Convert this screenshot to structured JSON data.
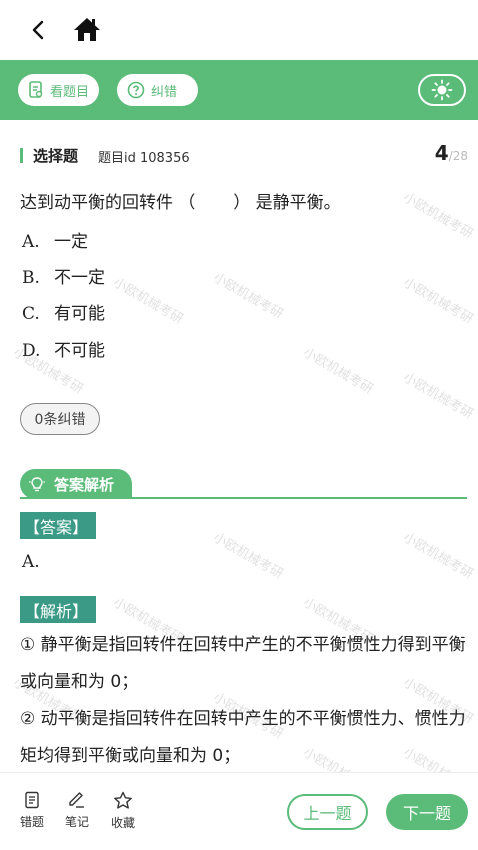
{
  "nav": {
    "back_icon": "chevron-left-icon",
    "home_icon": "home-icon"
  },
  "toolbar": {
    "view_question_label": "看题目",
    "correction_label": "纠错",
    "theme_icon": "sun-icon",
    "accent_color": "#5bbb78"
  },
  "question": {
    "type": "选择题",
    "id_label": "题目id 108356",
    "current": "4",
    "total": "/28",
    "stem": "达到动平衡的回转件 （       ） 是静平衡。",
    "options": [
      {
        "letter": "A.",
        "text": "一定"
      },
      {
        "letter": "B.",
        "text": "不一定"
      },
      {
        "letter": "C.",
        "text": "有可能"
      },
      {
        "letter": "D.",
        "text": "不可能"
      }
    ],
    "correction_count_label": "0条纠错"
  },
  "analysis": {
    "header": "答案解析",
    "answer_tag": "【答案】",
    "answer": "A.",
    "explain_tag": "【解析】",
    "paragraphs": [
      "① 静平衡是指回转件在回转中产生的不平衡惯性力得到平衡或向量和为 0；",
      "② 动平衡是指回转件在回转中产生的不平衡惯性力、惯性力矩均得到平衡或向量和为 0；"
    ]
  },
  "watermark": "小欧机械考研",
  "bottom": {
    "wrong_label": "错题",
    "notes_label": "笔记",
    "fav_label": "收藏",
    "prev_label": "上一题",
    "next_label": "下一题"
  }
}
